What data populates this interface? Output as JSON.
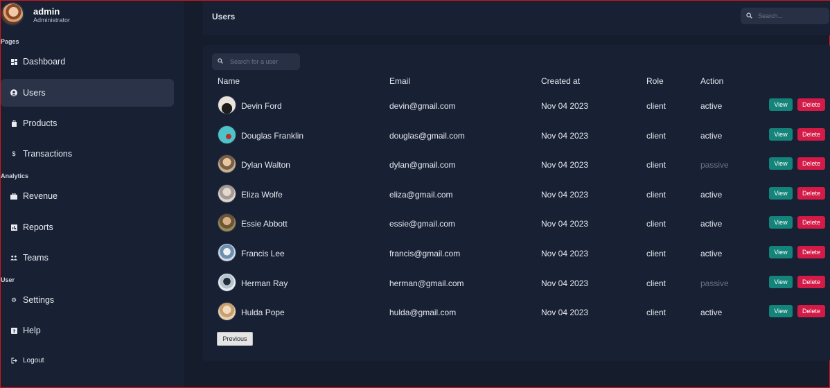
{
  "sidebar": {
    "user": {
      "name": "admin",
      "role": "Administrator"
    },
    "sections": [
      {
        "title": "Pages",
        "items": [
          {
            "label": "Dashboard",
            "icon": "dashboard-icon"
          },
          {
            "label": "Users",
            "icon": "user-icon",
            "active": true
          },
          {
            "label": "Products",
            "icon": "bag-icon"
          },
          {
            "label": "Transactions",
            "icon": "dollar-icon"
          }
        ]
      },
      {
        "title": "Analytics",
        "items": [
          {
            "label": "Revenue",
            "icon": "briefcase-icon"
          },
          {
            "label": "Reports",
            "icon": "report-icon"
          },
          {
            "label": "Teams",
            "icon": "team-icon"
          }
        ]
      },
      {
        "title": "User",
        "items": [
          {
            "label": "Settings",
            "icon": "gear-icon"
          },
          {
            "label": "Help",
            "icon": "help-icon"
          }
        ]
      }
    ],
    "logout_label": "Logout"
  },
  "header": {
    "title": "Users",
    "search_placeholder": "Search..."
  },
  "table": {
    "search_placeholder": "Search for a user",
    "columns": [
      "Name",
      "Email",
      "Created at",
      "Role",
      "Action"
    ],
    "rows": [
      {
        "name": "Devin Ford",
        "email": "devin@gmail.com",
        "created": "Nov 04 2023",
        "role": "client",
        "status": "active"
      },
      {
        "name": "Douglas Franklin",
        "email": "douglas@gmail.com",
        "created": "Nov 04 2023",
        "role": "client",
        "status": "active"
      },
      {
        "name": "Dylan Walton",
        "email": "dylan@gmail.com",
        "created": "Nov 04 2023",
        "role": "client",
        "status": "passive"
      },
      {
        "name": "Eliza Wolfe",
        "email": "eliza@gmail.com",
        "created": "Nov 04 2023",
        "role": "client",
        "status": "active"
      },
      {
        "name": "Essie Abbott",
        "email": "essie@gmail.com",
        "created": "Nov 04 2023",
        "role": "client",
        "status": "active"
      },
      {
        "name": "Francis Lee",
        "email": "francis@gmail.com",
        "created": "Nov 04 2023",
        "role": "client",
        "status": "active"
      },
      {
        "name": "Herman Ray",
        "email": "herman@gmail.com",
        "created": "Nov 04 2023",
        "role": "client",
        "status": "passive"
      },
      {
        "name": "Hulda Pope",
        "email": "hulda@gmail.com",
        "created": "Nov 04 2023",
        "role": "client",
        "status": "active"
      }
    ],
    "view_label": "View",
    "delete_label": "Delete",
    "previous_label": "Previous"
  },
  "colors": {
    "background": "#151c2c",
    "panel": "#182033",
    "view_button": "#14847a",
    "delete_button": "#d41a47",
    "passive_text": "#6c7585"
  }
}
